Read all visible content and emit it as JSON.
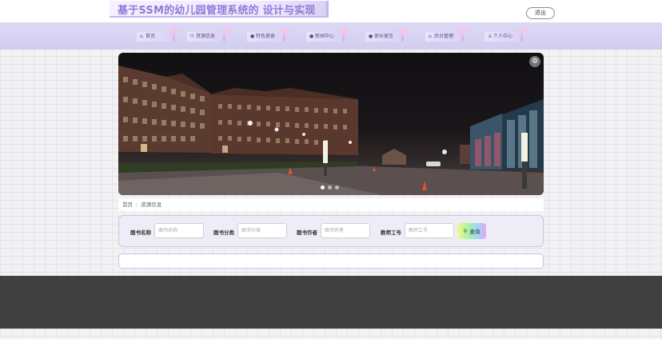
{
  "header": {
    "title": "基于SSM的幼儿园管理系统的 设计与实现",
    "logout_label": "退出"
  },
  "nav": {
    "items": [
      {
        "label": "首页",
        "icon": "home-icon"
      },
      {
        "label": "资源信息",
        "icon": "lock-icon"
      },
      {
        "label": "特色美食",
        "icon": "circle-icon"
      },
      {
        "label": "新闻中心",
        "icon": "circle-icon"
      },
      {
        "label": "家长留言",
        "icon": "circle-icon"
      },
      {
        "label": "后台管理",
        "icon": "bank-icon"
      },
      {
        "label": "个人中心",
        "icon": "user-icon"
      }
    ]
  },
  "banner": {
    "image": "campus-night-photo",
    "dots_total": 3,
    "dots_active_index": 0
  },
  "breadcrumb": {
    "home": "首页",
    "current": "资源信息"
  },
  "search": {
    "fields": [
      {
        "label": "图书名称",
        "placeholder": "图书名称"
      },
      {
        "label": "图书分类",
        "placeholder": "图书分类"
      },
      {
        "label": "图书作者",
        "placeholder": "图书作者"
      },
      {
        "label": "教师工号",
        "placeholder": "教师工号"
      }
    ],
    "button_label": "查询"
  },
  "colors": {
    "accent": "#8f7ad8",
    "nav_bg": "#d6d1f1",
    "footer_bg": "#404040"
  }
}
